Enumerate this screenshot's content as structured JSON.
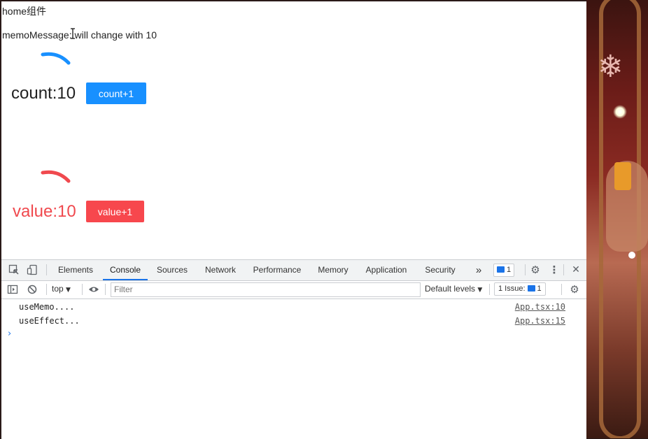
{
  "page": {
    "home_title": "home组件",
    "memo_message": "memoMessage: will change with 10",
    "count_text": "count:10",
    "count_button": "count+1",
    "value_text": "value:10",
    "value_button": "value+1",
    "colors": {
      "count_accent": "#1890ff",
      "value_accent": "#f7474d"
    }
  },
  "devtools": {
    "tabs": [
      {
        "label": "Elements",
        "active": false
      },
      {
        "label": "Console",
        "active": true
      },
      {
        "label": "Sources",
        "active": false
      },
      {
        "label": "Network",
        "active": false
      },
      {
        "label": "Performance",
        "active": false
      },
      {
        "label": "Memory",
        "active": false
      },
      {
        "label": "Application",
        "active": false
      },
      {
        "label": "Security",
        "active": false
      }
    ],
    "more_tabs": "»",
    "message_badge": "1",
    "filter": {
      "context": "top",
      "placeholder": "Filter",
      "levels": "Default levels",
      "issues": "1 Issue:",
      "issues_count": "1"
    },
    "logs": [
      {
        "message": "useMemo....",
        "source": "App.tsx:10"
      },
      {
        "message": "useEffect...",
        "source": "App.tsx:15"
      }
    ],
    "prompt": "›"
  }
}
